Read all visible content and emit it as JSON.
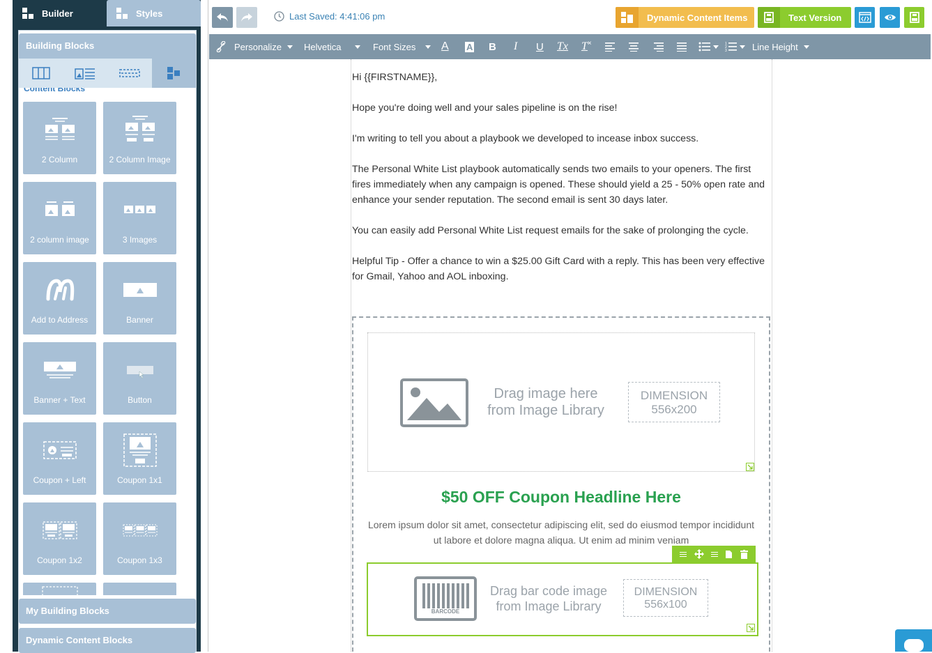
{
  "left_panel": {
    "tabs": {
      "builder": "Builder",
      "styles": "Styles"
    },
    "header": "Building Blocks",
    "block_type_tabs": [
      "columns-icon",
      "image-text-icon",
      "divider-icon",
      "content-blocks-icon"
    ],
    "content_blocks_label": "Content Blocks",
    "blocks": [
      {
        "label": "2 Column",
        "icon": "two-column-icon"
      },
      {
        "label": "2 Column Image",
        "icon": "two-column-image-icon"
      },
      {
        "label": "2 column image",
        "icon": "two-images-icon"
      },
      {
        "label": "3 Images",
        "icon": "three-images-icon"
      },
      {
        "label": "Add to Address",
        "icon": "logo-m-icon"
      },
      {
        "label": "Banner",
        "icon": "banner-icon"
      },
      {
        "label": "Banner + Text",
        "icon": "banner-text-icon"
      },
      {
        "label": "Button",
        "icon": "button-icon"
      },
      {
        "label": "Coupon + Left",
        "icon": "coupon-left-icon"
      },
      {
        "label": "Coupon 1x1",
        "icon": "coupon-1x1-icon"
      },
      {
        "label": "Coupon 1x2",
        "icon": "coupon-1x2-icon"
      },
      {
        "label": "Coupon 1x3",
        "icon": "coupon-1x3-icon"
      }
    ],
    "sections": {
      "my_blocks": "My Building Blocks",
      "dynamic_blocks": "Dynamic Content Blocks"
    }
  },
  "topbar": {
    "last_saved": "Last Saved: 4:41:06 pm",
    "dynamic_content": "Dynamic Content Items",
    "text_version": "Text Version"
  },
  "format_toolbar": {
    "personalize": "Personalize",
    "font": "Helvetica",
    "font_sizes": "Font Sizes",
    "font_color": "A",
    "bg_color": "A",
    "bold": "B",
    "italic": "I",
    "underline": "U",
    "clear_format": "Tx",
    "superscript": "T",
    "line_height": "Line Height"
  },
  "email": {
    "greeting": "Hi {{FIRSTNAME}},",
    "p1": "Hope you're doing well and your sales pipeline is on the rise!",
    "p2": "I'm writing to tell you about a playbook we developed to incease inbox success.",
    "p3": "The Personal White List playbook automatically sends two emails to your openers. The first fires immediately when any campaign is opened. These should yield a 25 - 50% open rate and enhance your sender reputation. The second email is sent 30 days later.",
    "p4": "You can easily add Personal White List request emails for the sake of prolonging the cycle.",
    "p5": "Helpful Tip -  Offer a chance to win a $25.00 Gift Card with a reply. This has been very effective for Gmail, Yahoo and AOL inboxing.",
    "image_drop": {
      "line1": "Drag image here",
      "line2": "from Image Library",
      "dim_label": "DIMENSION",
      "dim_value": "556x200"
    },
    "coupon_headline": "$50 OFF Coupon Headline Here",
    "coupon_body": "Lorem ipsum dolor sit amet, consectetur adipiscing elit, sed do eiusmod tempor incididunt ut labore et dolore magna aliqua. Ut enim ad minim veniam",
    "barcode_drop": {
      "line1": "Drag bar code image",
      "line2": "from Image Library",
      "dim_label": "DIMENSION",
      "dim_value": "556x100",
      "barcode_caption": "BARCODE"
    }
  },
  "colors": {
    "panel_dark": "#1d3a48",
    "tile": "#a8c0d6",
    "toolbar": "#7f96a7",
    "orange": "#f2bd4e",
    "green": "#8ccc2e",
    "blue": "#2a9bd5",
    "headline_green": "#2aa150"
  }
}
